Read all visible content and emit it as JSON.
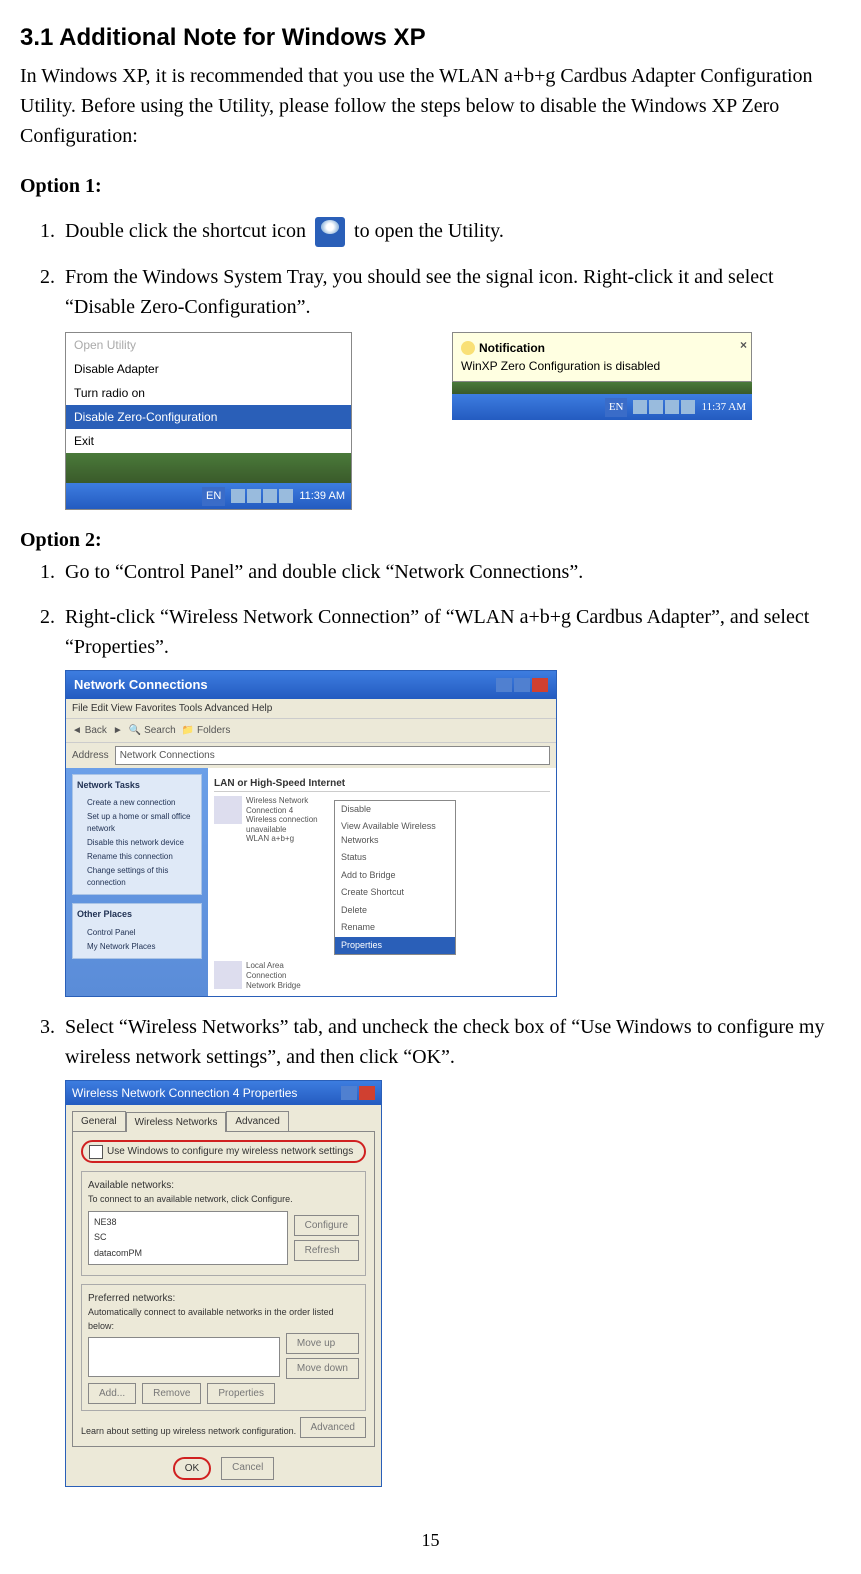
{
  "heading": "3.1 Additional Note for Windows XP",
  "intro": "In Windows XP, it is recommended that you use the WLAN a+b+g Cardbus Adapter Configuration Utility.    Before using the Utility, please follow the steps below to disable the Windows XP Zero Configuration:",
  "option1": {
    "heading": "Option 1:",
    "items": {
      "0": {
        "pre": "Double click the shortcut icon ",
        "post": "  to open the Utility."
      },
      "1": "From the Windows System Tray, you should see the signal icon.    Right-click it and select “Disable Zero-Configuration”."
    },
    "menu": {
      "items": {
        "0": "Open Utility",
        "1": "Disable Adapter",
        "2": "Turn radio on",
        "3": "Disable Zero-Configuration",
        "4": "Exit"
      }
    },
    "taskbar1": {
      "lang": "EN",
      "time": "11:39 AM"
    },
    "balloon": {
      "title": "Notification",
      "body": "WinXP Zero Configuration is disabled"
    },
    "taskbar2": {
      "lang": "EN",
      "time": "11:37 AM"
    }
  },
  "option2": {
    "heading": "Option 2:",
    "items": {
      "0": "Go to “Control Panel” and double click “Network Connections”.",
      "1": "Right-click “Wireless Network Connection” of “WLAN a+b+g Cardbus Adapter”, and select “Properties”.",
      "2": "Select “Wireless Networks” tab, and uncheck the check box of “Use Windows to configure my wireless network settings”, and then click “OK”."
    }
  },
  "nc": {
    "title": "Network Connections",
    "menubar": "File   Edit   View   Favorites   Tools   Advanced   Help",
    "toolbar": {
      "back": "Back",
      "search": "Search",
      "folders": "Folders"
    },
    "address": {
      "label": "Address",
      "value": "Network Connections"
    },
    "side": {
      "tasks": {
        "head": "Network Tasks",
        "i0": "Create a new connection",
        "i1": "Set up a home or small office network",
        "i2": "Disable this network device",
        "i3": "Rename this connection",
        "i4": "Change settings of this connection"
      },
      "other": {
        "head": "Other Places",
        "i0": "Control Panel",
        "i1": "My Network Places"
      }
    },
    "main": {
      "group": "LAN or High-Speed Internet",
      "item1": {
        "l1": "Wireless Network Connection 4",
        "l2": "Wireless connection unavailable",
        "l3": "WLAN a+b+g"
      },
      "item2": {
        "l1": "Local Area Connection",
        "l2": "Network Bridge"
      },
      "ctx": {
        "i0": "Disable",
        "i1": "View Available Wireless Networks",
        "i2": "Status",
        "i3": "Add to Bridge",
        "i4": "Create Shortcut",
        "i5": "Delete",
        "i6": "Rename",
        "i7": "Properties"
      }
    }
  },
  "props": {
    "title": "Wireless Network Connection 4 Properties",
    "tabs": {
      "t0": "General",
      "t1": "Wireless Networks",
      "t2": "Advanced"
    },
    "chk": "Use Windows to configure my wireless network settings",
    "avail": {
      "label": "Available networks:",
      "desc": "To connect to an available network, click Configure.",
      "n0": "NE38",
      "n1": "SC",
      "n2": "datacomPM",
      "btns": {
        "b0": "Configure",
        "b1": "Refresh"
      }
    },
    "pref": {
      "label": "Preferred networks:",
      "desc": "Automatically connect to available networks in the order listed below:",
      "btns": {
        "b0": "Move up",
        "b1": "Move down",
        "b2": "Add...",
        "b3": "Remove",
        "b4": "Properties"
      }
    },
    "learn": "Learn about setting up wireless network configuration.",
    "btns": {
      "adv": "Advanced",
      "ok": "OK",
      "cancel": "Cancel"
    }
  },
  "pageNumber": "15"
}
